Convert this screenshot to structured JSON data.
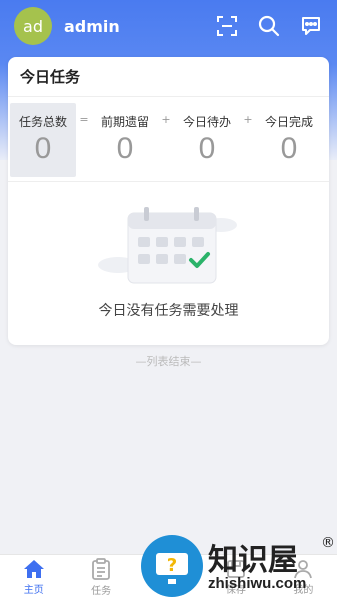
{
  "user": {
    "avatar_text": "ad",
    "name": "admin"
  },
  "header_icons": [
    "scan-icon",
    "search-icon",
    "message-icon"
  ],
  "card": {
    "title": "今日任务",
    "stats": [
      {
        "label": "任务总数",
        "value": "0"
      },
      {
        "label": "前期遗留",
        "value": "0"
      },
      {
        "label": "今日待办",
        "value": "0"
      },
      {
        "label": "今日完成",
        "value": "0"
      }
    ],
    "operators": [
      "=",
      "+",
      "+"
    ],
    "empty_text": "今日没有任务需要处理"
  },
  "list_end": "—列表结束—",
  "tabbar": [
    {
      "label": "主页",
      "icon": "home-icon",
      "active": true
    },
    {
      "label": "任务",
      "icon": "clipboard-icon",
      "active": false
    },
    {
      "label": "",
      "icon": "center-icon",
      "active": false
    },
    {
      "label": "保存",
      "icon": "save-icon",
      "active": false
    },
    {
      "label": "我的",
      "icon": "user-icon",
      "active": false
    }
  ],
  "watermark": {
    "text": "知识屋",
    "sub": "zhishiwu.com",
    "mark": "®"
  },
  "colors": {
    "primary": "#4a7bf0",
    "avatar": "#a5c24d",
    "check": "#2bb36a"
  }
}
